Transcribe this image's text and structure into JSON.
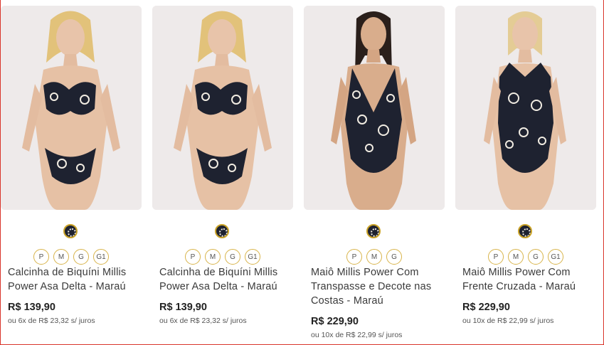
{
  "accent_color": "#d8b44a",
  "swatch_color": "#1e2230",
  "products": [
    {
      "name": "Calcinha de Biquíni Millis Power Asa Delta - Maraú",
      "sizes": [
        "P",
        "M",
        "G",
        "G1"
      ],
      "price": "R$ 139,90",
      "installments": "ou 6x de R$ 23,32 s/ juros",
      "image_icon": "model-bikini-photo"
    },
    {
      "name": "Calcinha de Biquíni Millis Power Asa Delta - Maraú",
      "sizes": [
        "P",
        "M",
        "G",
        "G1"
      ],
      "price": "R$ 139,90",
      "installments": "ou 6x de R$ 23,32 s/ juros",
      "image_icon": "model-bikini-photo"
    },
    {
      "name": "Maiô Millis Power Com Transpasse e Decote nas Costas - Maraú",
      "sizes": [
        "P",
        "M",
        "G"
      ],
      "price": "R$ 229,90",
      "installments": "ou 10x de R$ 22,99 s/ juros",
      "image_icon": "model-swimsuit-photo"
    },
    {
      "name": "Maiô Millis Power Com Frente Cruzada - Maraú",
      "sizes": [
        "P",
        "M",
        "G",
        "G1"
      ],
      "price": "R$ 229,90",
      "installments": "ou 10x de R$ 22,99 s/ juros",
      "image_icon": "model-swimsuit-photo"
    }
  ]
}
